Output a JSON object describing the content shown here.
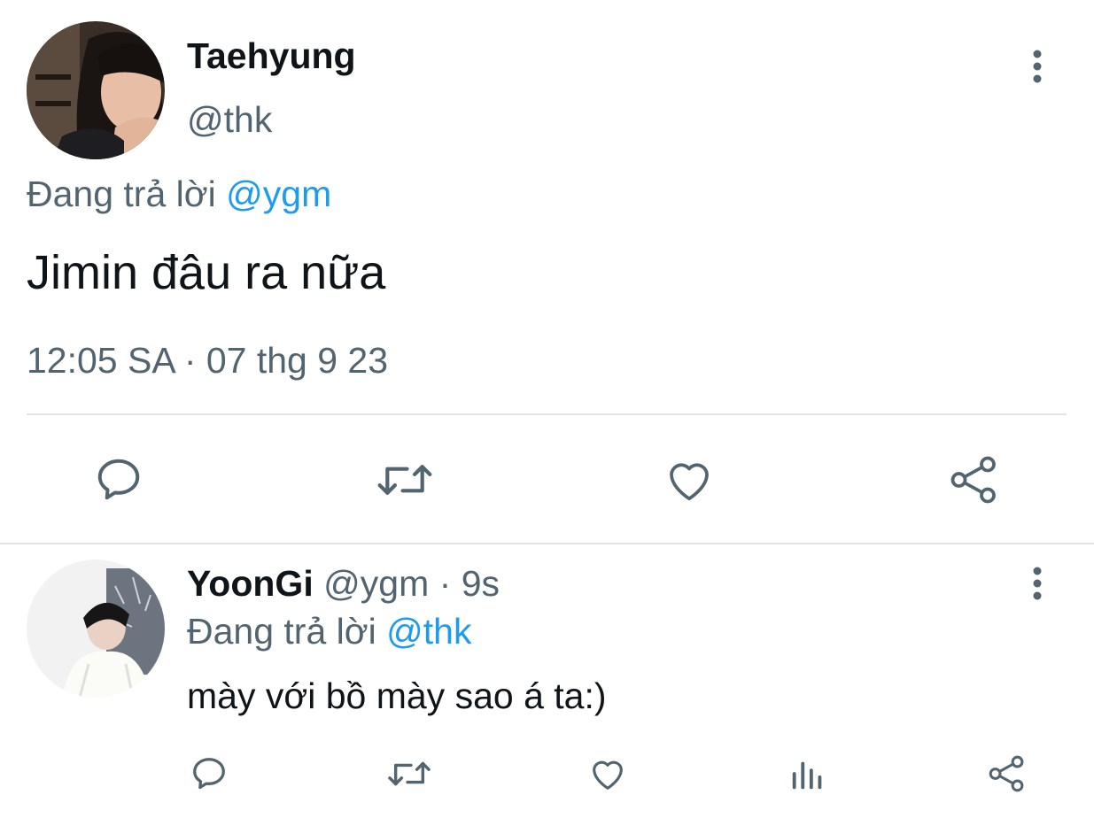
{
  "main_tweet": {
    "display_name": "Taehyung",
    "handle": "@thk",
    "reply_prefix": "Đang trả lời",
    "reply_to": "@ygm",
    "text": "Jimin đâu ra nữa",
    "timestamp": "12:05 SA · 07 thg 9 23"
  },
  "reply_tweet": {
    "display_name": "YoonGi",
    "handle": "@ygm",
    "separator": "·",
    "time_ago": "9s",
    "reply_prefix": "Đang trả lời",
    "reply_to": "@thk",
    "text": "mày với bồ mày sao á ta:)"
  },
  "icons": {
    "more": "more-vertical-icon",
    "reply": "reply-icon",
    "retweet": "retweet-icon",
    "like": "heart-icon",
    "views": "views-icon",
    "share": "share-icon"
  },
  "colors": {
    "text": "#0f1419",
    "secondary": "#536471",
    "link": "#1d9bf0",
    "divider": "#e1e4e7"
  }
}
